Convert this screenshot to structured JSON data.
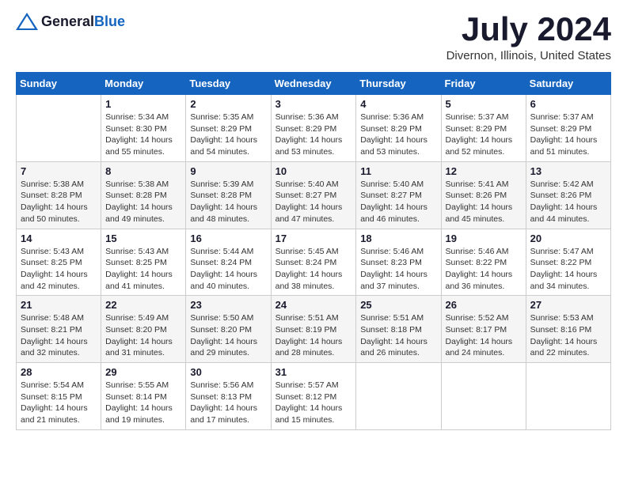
{
  "logo": {
    "text_general": "General",
    "text_blue": "Blue"
  },
  "title": "July 2024",
  "subtitle": "Divernon, Illinois, United States",
  "days_header": [
    "Sunday",
    "Monday",
    "Tuesday",
    "Wednesday",
    "Thursday",
    "Friday",
    "Saturday"
  ],
  "weeks": [
    [
      {
        "day": "",
        "info": ""
      },
      {
        "day": "1",
        "info": "Sunrise: 5:34 AM\nSunset: 8:30 PM\nDaylight: 14 hours\nand 55 minutes."
      },
      {
        "day": "2",
        "info": "Sunrise: 5:35 AM\nSunset: 8:29 PM\nDaylight: 14 hours\nand 54 minutes."
      },
      {
        "day": "3",
        "info": "Sunrise: 5:36 AM\nSunset: 8:29 PM\nDaylight: 14 hours\nand 53 minutes."
      },
      {
        "day": "4",
        "info": "Sunrise: 5:36 AM\nSunset: 8:29 PM\nDaylight: 14 hours\nand 53 minutes."
      },
      {
        "day": "5",
        "info": "Sunrise: 5:37 AM\nSunset: 8:29 PM\nDaylight: 14 hours\nand 52 minutes."
      },
      {
        "day": "6",
        "info": "Sunrise: 5:37 AM\nSunset: 8:29 PM\nDaylight: 14 hours\nand 51 minutes."
      }
    ],
    [
      {
        "day": "7",
        "info": "Sunrise: 5:38 AM\nSunset: 8:28 PM\nDaylight: 14 hours\nand 50 minutes."
      },
      {
        "day": "8",
        "info": "Sunrise: 5:38 AM\nSunset: 8:28 PM\nDaylight: 14 hours\nand 49 minutes."
      },
      {
        "day": "9",
        "info": "Sunrise: 5:39 AM\nSunset: 8:28 PM\nDaylight: 14 hours\nand 48 minutes."
      },
      {
        "day": "10",
        "info": "Sunrise: 5:40 AM\nSunset: 8:27 PM\nDaylight: 14 hours\nand 47 minutes."
      },
      {
        "day": "11",
        "info": "Sunrise: 5:40 AM\nSunset: 8:27 PM\nDaylight: 14 hours\nand 46 minutes."
      },
      {
        "day": "12",
        "info": "Sunrise: 5:41 AM\nSunset: 8:26 PM\nDaylight: 14 hours\nand 45 minutes."
      },
      {
        "day": "13",
        "info": "Sunrise: 5:42 AM\nSunset: 8:26 PM\nDaylight: 14 hours\nand 44 minutes."
      }
    ],
    [
      {
        "day": "14",
        "info": "Sunrise: 5:43 AM\nSunset: 8:25 PM\nDaylight: 14 hours\nand 42 minutes."
      },
      {
        "day": "15",
        "info": "Sunrise: 5:43 AM\nSunset: 8:25 PM\nDaylight: 14 hours\nand 41 minutes."
      },
      {
        "day": "16",
        "info": "Sunrise: 5:44 AM\nSunset: 8:24 PM\nDaylight: 14 hours\nand 40 minutes."
      },
      {
        "day": "17",
        "info": "Sunrise: 5:45 AM\nSunset: 8:24 PM\nDaylight: 14 hours\nand 38 minutes."
      },
      {
        "day": "18",
        "info": "Sunrise: 5:46 AM\nSunset: 8:23 PM\nDaylight: 14 hours\nand 37 minutes."
      },
      {
        "day": "19",
        "info": "Sunrise: 5:46 AM\nSunset: 8:22 PM\nDaylight: 14 hours\nand 36 minutes."
      },
      {
        "day": "20",
        "info": "Sunrise: 5:47 AM\nSunset: 8:22 PM\nDaylight: 14 hours\nand 34 minutes."
      }
    ],
    [
      {
        "day": "21",
        "info": "Sunrise: 5:48 AM\nSunset: 8:21 PM\nDaylight: 14 hours\nand 32 minutes."
      },
      {
        "day": "22",
        "info": "Sunrise: 5:49 AM\nSunset: 8:20 PM\nDaylight: 14 hours\nand 31 minutes."
      },
      {
        "day": "23",
        "info": "Sunrise: 5:50 AM\nSunset: 8:20 PM\nDaylight: 14 hours\nand 29 minutes."
      },
      {
        "day": "24",
        "info": "Sunrise: 5:51 AM\nSunset: 8:19 PM\nDaylight: 14 hours\nand 28 minutes."
      },
      {
        "day": "25",
        "info": "Sunrise: 5:51 AM\nSunset: 8:18 PM\nDaylight: 14 hours\nand 26 minutes."
      },
      {
        "day": "26",
        "info": "Sunrise: 5:52 AM\nSunset: 8:17 PM\nDaylight: 14 hours\nand 24 minutes."
      },
      {
        "day": "27",
        "info": "Sunrise: 5:53 AM\nSunset: 8:16 PM\nDaylight: 14 hours\nand 22 minutes."
      }
    ],
    [
      {
        "day": "28",
        "info": "Sunrise: 5:54 AM\nSunset: 8:15 PM\nDaylight: 14 hours\nand 21 minutes."
      },
      {
        "day": "29",
        "info": "Sunrise: 5:55 AM\nSunset: 8:14 PM\nDaylight: 14 hours\nand 19 minutes."
      },
      {
        "day": "30",
        "info": "Sunrise: 5:56 AM\nSunset: 8:13 PM\nDaylight: 14 hours\nand 17 minutes."
      },
      {
        "day": "31",
        "info": "Sunrise: 5:57 AM\nSunset: 8:12 PM\nDaylight: 14 hours\nand 15 minutes."
      },
      {
        "day": "",
        "info": ""
      },
      {
        "day": "",
        "info": ""
      },
      {
        "day": "",
        "info": ""
      }
    ]
  ]
}
